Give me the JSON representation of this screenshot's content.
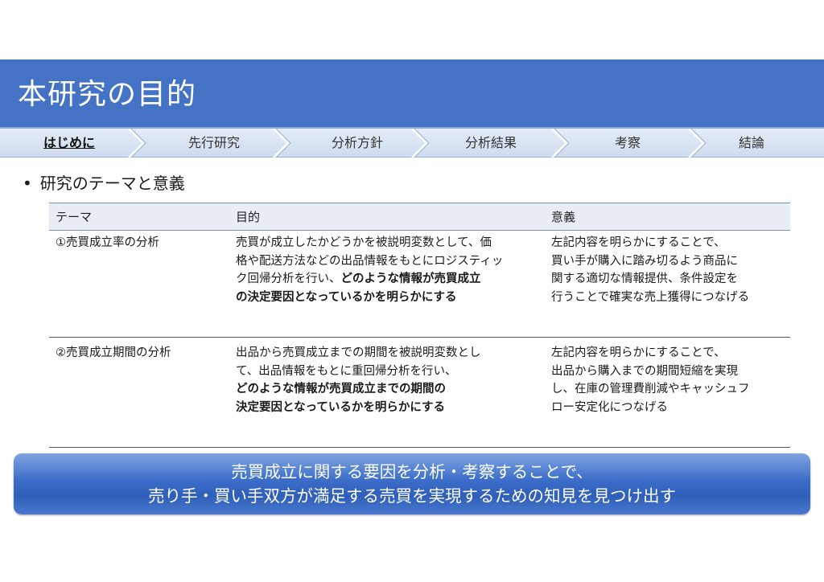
{
  "slide": {
    "title": "本研究の目的"
  },
  "nav": {
    "steps": [
      {
        "label": "はじめに",
        "active": true
      },
      {
        "label": "先行研究",
        "active": false
      },
      {
        "label": "分析方針",
        "active": false
      },
      {
        "label": "分析結果",
        "active": false
      },
      {
        "label": "考察",
        "active": false
      },
      {
        "label": "結論",
        "active": false
      }
    ]
  },
  "section": {
    "bullet": "•",
    "heading": "研究のテーマと意義"
  },
  "table": {
    "headers": [
      "テーマ",
      "目的",
      "意義"
    ],
    "rows": [
      {
        "theme": "①売買成立率の分析",
        "purpose": [
          {
            "text": "売買が成立したかどうかを被説明変数として、価",
            "bold": false
          },
          {
            "text": "格や配送方法などの出品情報をもとにロジスティッ",
            "bold": false
          },
          {
            "text": "ク回帰分析を行い、",
            "bold": false,
            "tail": "どのような情報が売買成立"
          },
          {
            "text": "の決定要因となっているかを明らかにする",
            "bold": true
          }
        ],
        "significance": [
          "左記内容を明らかにすることで、",
          "買い手が購入に踏み切るよう商品に",
          "関する適切な情報提供、条件設定を",
          "行うことで確実な売上獲得につなげる"
        ]
      },
      {
        "theme": "②売買成立期間の分析",
        "purpose": [
          {
            "text": "出品から売買成立までの期間を被説明変数とし",
            "bold": false
          },
          {
            "text": "て、出品情報をもとに重回帰分析を行い、",
            "bold": false
          },
          {
            "text": "どのような情報が売買成立までの期間の",
            "bold": true
          },
          {
            "text": "決定要因となっているかを明らかにする",
            "bold": true
          }
        ],
        "significance": [
          "左記内容を明らかにすることで、",
          "出品から購入までの期間短縮を実現",
          "し、在庫の管理費削減やキャッシュフ",
          "ロー安定化につなげる"
        ]
      }
    ]
  },
  "banner": {
    "line1": "売買成立に関する要因を分析・考察することで、",
    "line2": "売り手・買い手双方が満足する売買を実現するための知見を見つけ出す"
  },
  "colors": {
    "title_bar": "#4472c4",
    "nav_bg": "#dbe5f3",
    "table_header_bg": "#e8edf6",
    "banner": "#3b6cc8"
  }
}
